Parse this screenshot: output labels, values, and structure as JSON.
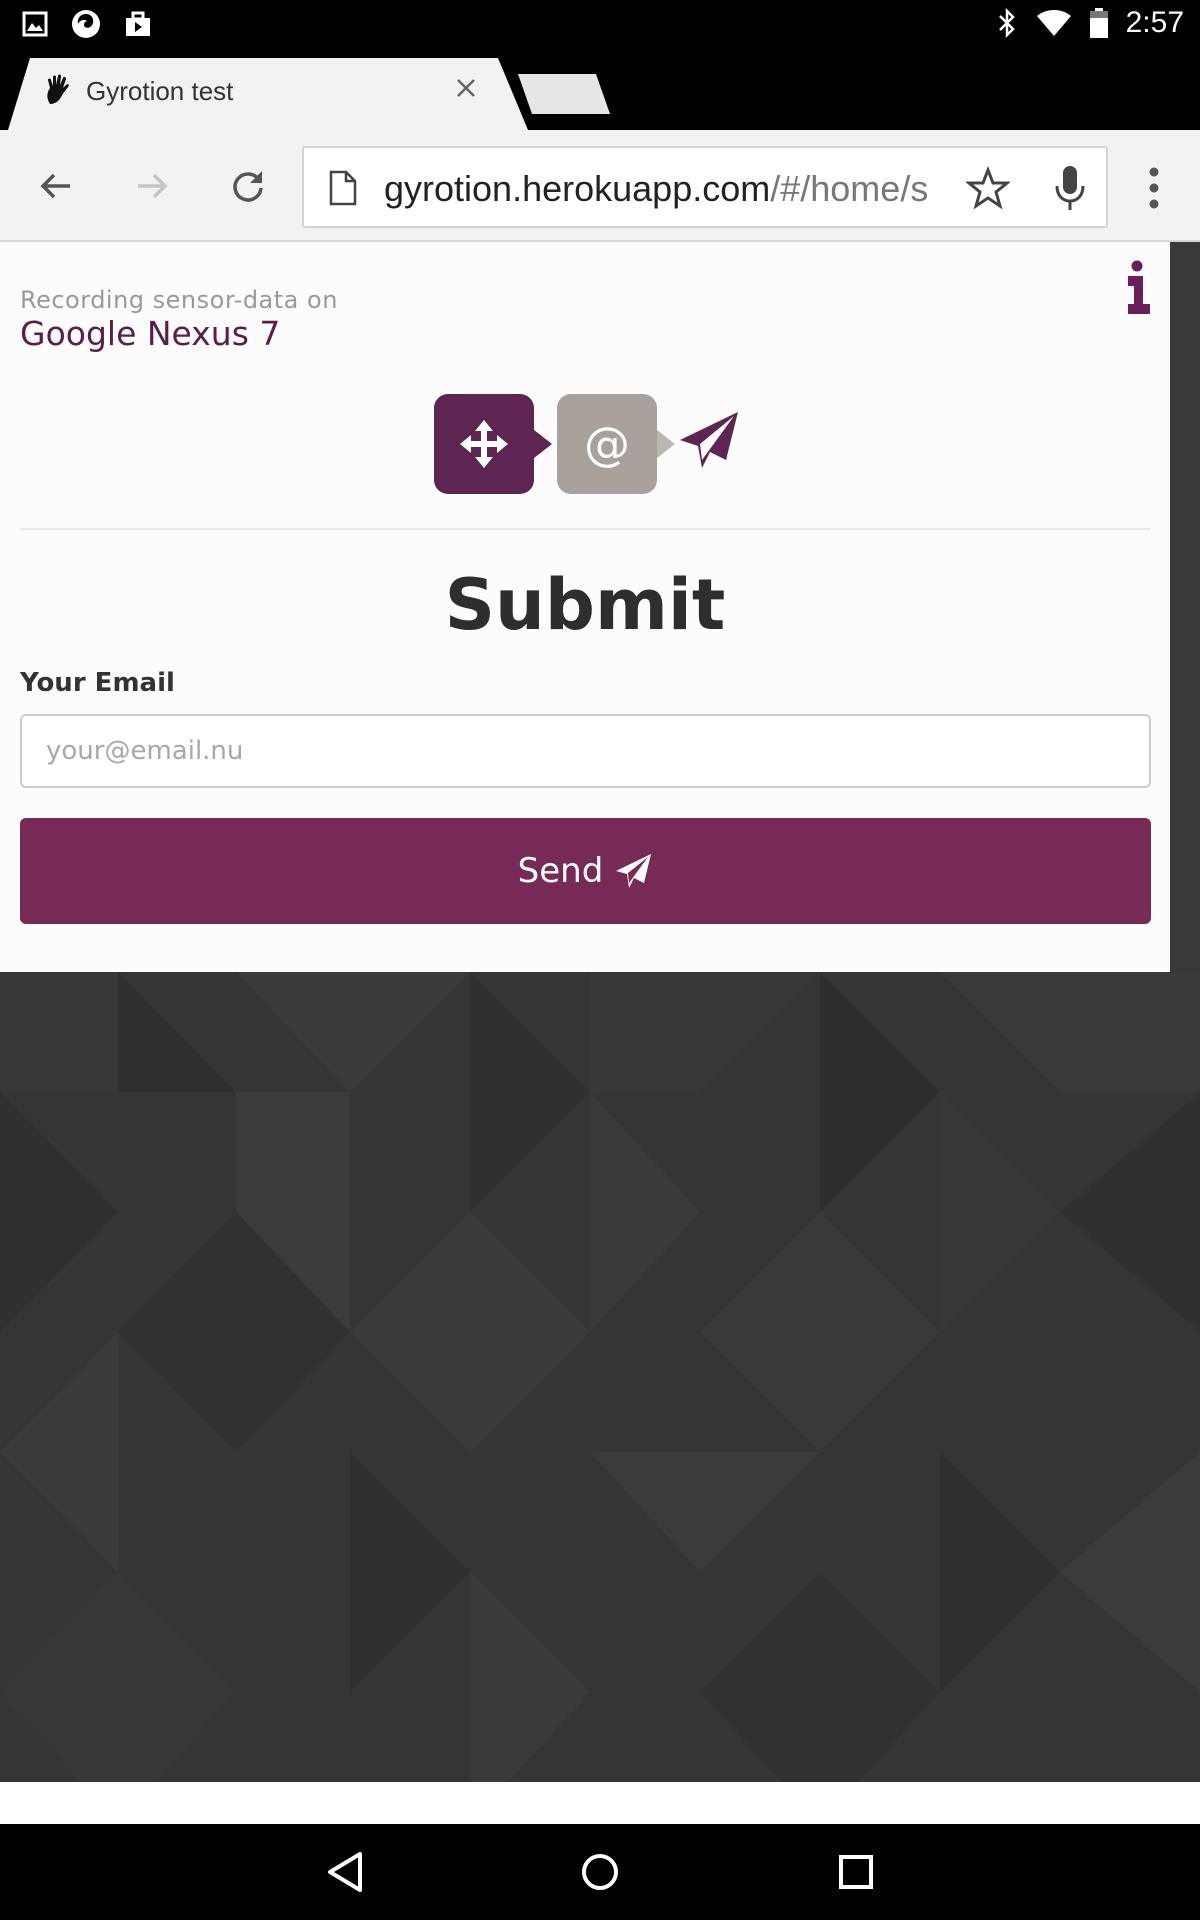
{
  "status_bar": {
    "time": "2:57",
    "icons": [
      "gallery-icon",
      "firefox-icon",
      "briefcase-icon",
      "bluetooth-icon",
      "wifi-icon",
      "battery-icon"
    ]
  },
  "tab": {
    "title": "Gyrotion test",
    "favicon": "hand-icon"
  },
  "toolbar": {
    "url_host": "gyrotion.herokuapp.com",
    "url_path": "/#/home/s"
  },
  "page": {
    "recording_label": "Recording sensor-data on",
    "device_name": "Google Nexus 7",
    "steps": [
      {
        "icon": "move-arrows-icon",
        "state": "done"
      },
      {
        "label": "@",
        "state": "current"
      },
      {
        "icon": "paper-plane-icon",
        "state": "upcoming"
      }
    ],
    "heading": "Submit",
    "email_label": "Your Email",
    "email_placeholder": "your@email.nu",
    "email_value": "",
    "send_label": "Send"
  },
  "colors": {
    "brand_purple": "#762a55",
    "step_done": "#5e2552",
    "step_current": "#a9a19c",
    "background_dark": "#353535"
  },
  "nav_bar": {
    "buttons": [
      "back-icon",
      "home-icon",
      "recents-icon"
    ]
  }
}
